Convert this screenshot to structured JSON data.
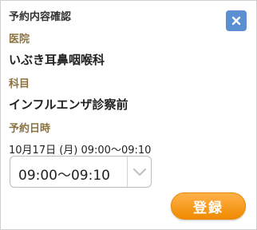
{
  "dialog": {
    "title": "予約内容確認",
    "close_icon": "close-icon"
  },
  "hospital": {
    "label": "医院",
    "value": "いぶき耳鼻咽喉科"
  },
  "department": {
    "label": "科目",
    "value": "インフルエンザ診察前"
  },
  "reservation": {
    "label": "予約日時",
    "datetime": "10月17日 (月) 09:00〜09:10",
    "time_select": {
      "selected": "09:00〜09:10",
      "arrow_icon": "chevron-down-icon"
    }
  },
  "actions": {
    "register_label": "登録"
  },
  "colors": {
    "close_button": "#5b8fd1",
    "label_text": "#8a7240",
    "register_button": "#f5960f"
  }
}
